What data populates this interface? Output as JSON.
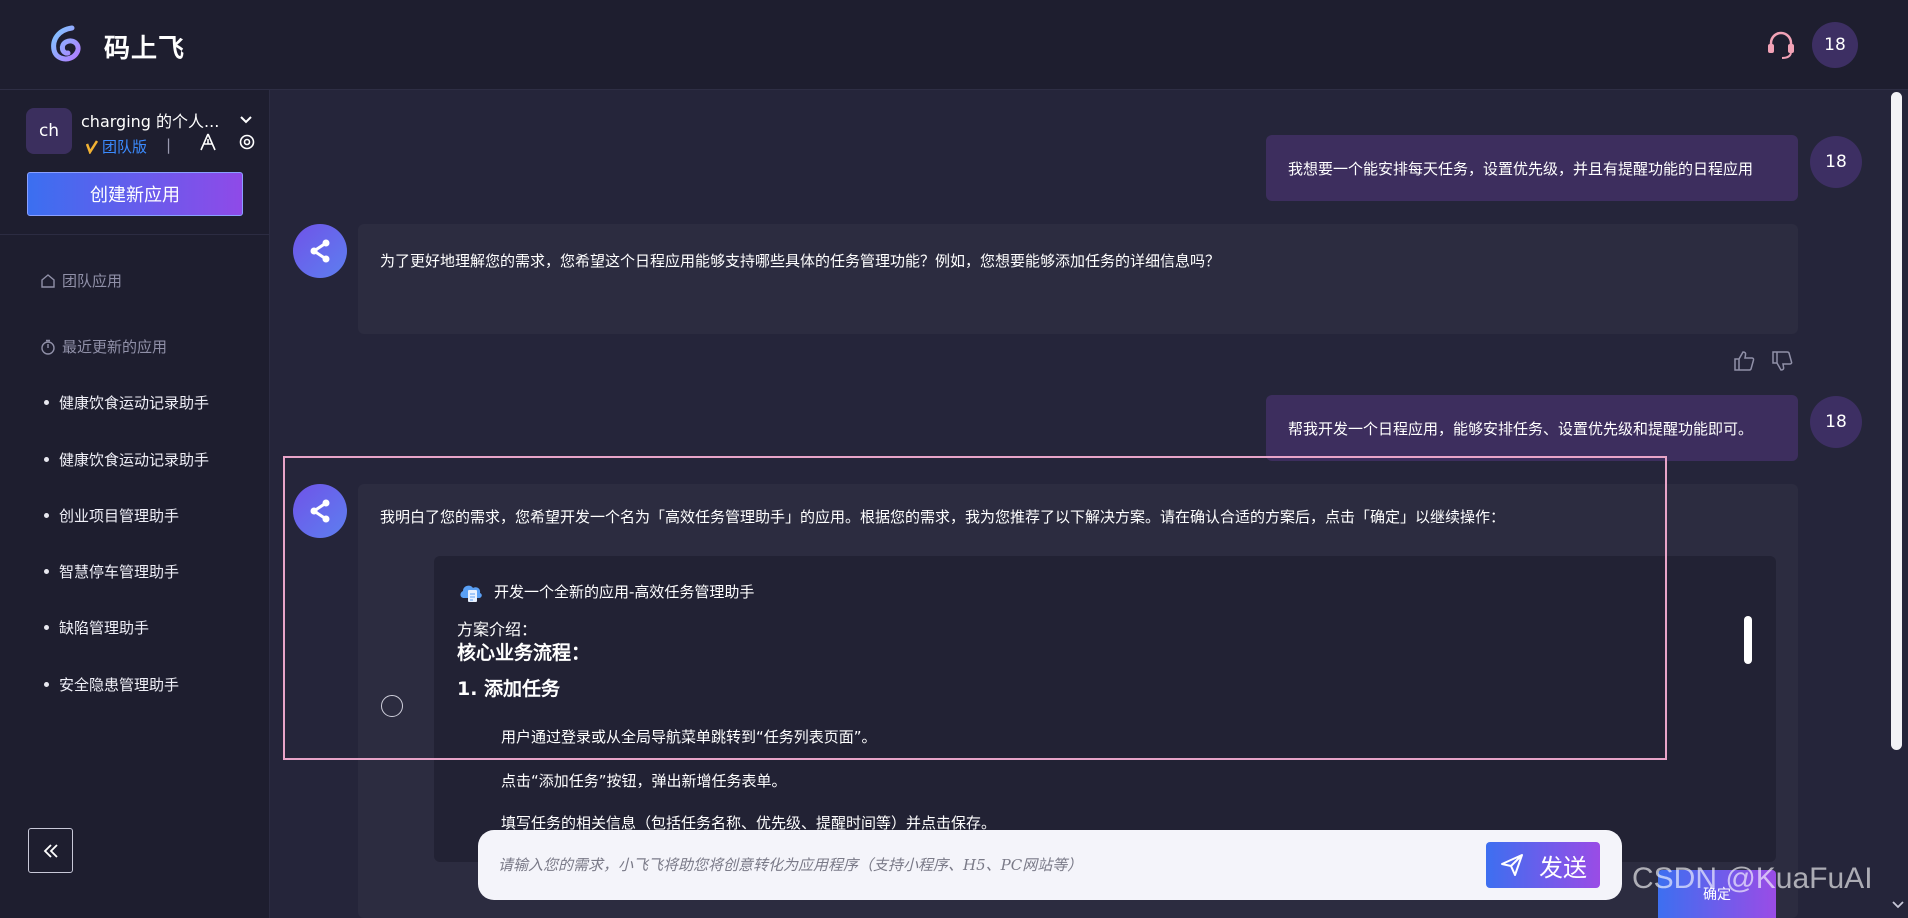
{
  "header": {
    "app_name": "码上飞",
    "user_avatar": "18"
  },
  "sidebar": {
    "workspace_avatar": "ch",
    "workspace_name": "charging 的个人...",
    "edition": "团队版",
    "edition_icon": "check-mark-icon",
    "separator": "|",
    "create_button": "创建新应用",
    "section_team": "团队应用",
    "section_recent": "最近更新的应用",
    "recent_items": [
      "健康饮食运动记录助手",
      "健康饮食运动记录助手",
      "创业项目管理助手",
      "智慧停车管理助手",
      "缺陷管理助手",
      "安全隐患管理助手"
    ]
  },
  "chat": {
    "user_avatar": "18",
    "messages": {
      "user_1": "我想要一个能安排每天任务，设置优先级，并且有提醒功能的日程应用",
      "bot_1": "为了更好地理解您的需求，您希望这个日程应用能够支持哪些具体的任务管理功能？例如，您想要能够添加任务的详细信息吗？",
      "user_2": "帮我开发一个日程应用，能够安排任务、设置优先级和提醒功能即可。",
      "bot_2": "我明白了您的需求，您希望开发一个名为「高效任务管理助手」的应用。根据您的需求，我为您推荐了以下解决方案。请在确认合适的方案后，点击「确定」以继续操作："
    },
    "solution": {
      "title": "开发一个全新的应用-高效任务管理助手",
      "intro_label": "方案介绍：",
      "heading": "核心业务流程：",
      "subheading": "1. 添加任务",
      "lines": [
        "用户通过登录或从全局导航菜单跳转到“任务列表页面”。",
        "点击“添加任务”按钮，弹出新增任务表单。",
        "填写任务的相关信息（包括任务名称、优先级、提醒时间等）并点击保存。"
      ]
    },
    "confirm_button": "确定"
  },
  "composer": {
    "placeholder": "请输入您的需求，小飞飞将助您将创意转化为应用程序（支持小程序、H5、PC网站等）",
    "send_label": "发送"
  },
  "watermark": "CSDN @KuaFuAI",
  "colors": {
    "accent_start": "#3d6ff0",
    "accent_end": "#9a4ce6",
    "user_bubble": "#3d2e5e",
    "bot_bubble": "#2c2c40",
    "highlight": "#e8a4c8"
  }
}
